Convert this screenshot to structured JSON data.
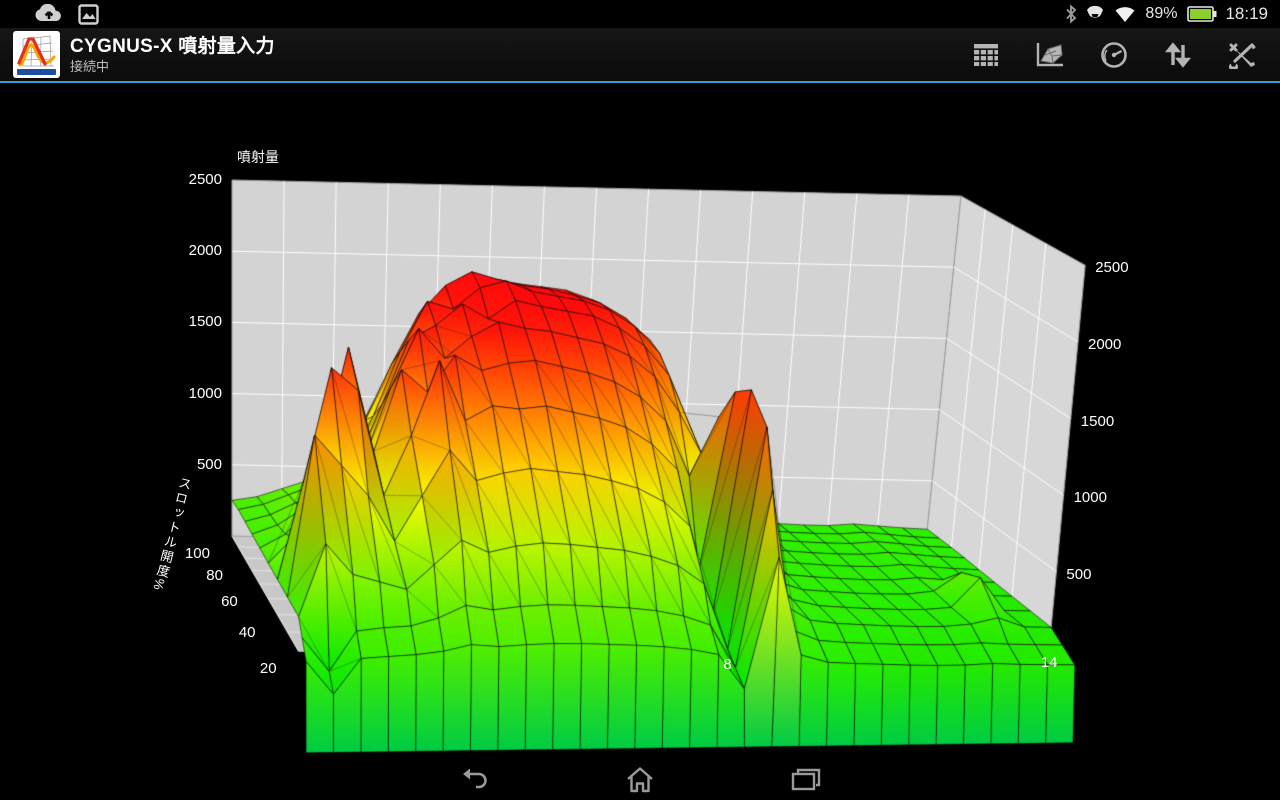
{
  "status_bar": {
    "time": "18:19",
    "battery_percent": "89%",
    "battery_color": "#8bd02a",
    "left_icons": [
      "cloud-upload",
      "gallery"
    ],
    "right_icons": [
      "bluetooth",
      "smart-connect",
      "wifi"
    ]
  },
  "app_bar": {
    "title": "CYGNUS-X 噴射量入力",
    "subtitle": "接続中",
    "accent_color": "#2f9fd0",
    "actions": [
      {
        "name": "table"
      },
      {
        "name": "surface-chart"
      },
      {
        "name": "gauge"
      },
      {
        "name": "transfer"
      },
      {
        "name": "settings-tools"
      }
    ]
  },
  "chart_data": {
    "type": "surface3d",
    "title": "噴射量",
    "y_label": "スロットル開度%",
    "zlim": [
      0,
      2500
    ],
    "z_ticks": [
      2500,
      2000,
      1500,
      1000,
      500
    ],
    "y_ticks": [
      100,
      80,
      60,
      40,
      20
    ],
    "x_ticks_shown": [
      8,
      14
    ],
    "x_range": [
      0,
      14
    ],
    "grid": true,
    "wall_color": "#d3d3d3",
    "right_wall_color": "#d7d7d7",
    "floor_color": "#c8c8c8",
    "background": "#000000",
    "palette": {
      "low": "#00e000",
      "mid": "#ffd800",
      "high": "#e83600"
    },
    "x": [
      0,
      0.5,
      1,
      1.5,
      2,
      2.5,
      3,
      3.5,
      4,
      4.5,
      5,
      5.5,
      6,
      6.5,
      7,
      7.5,
      8,
      8.5,
      9,
      9.5,
      10,
      10.5,
      11,
      11.5,
      12,
      12.5,
      13,
      13.5,
      14
    ],
    "y": [
      100,
      90,
      80,
      70,
      60,
      50,
      40,
      30,
      20,
      10,
      0
    ],
    "values": [
      [
        250,
        280,
        340,
        400,
        520,
        750,
        1100,
        1450,
        1700,
        1800,
        1850,
        1820,
        1800,
        1780,
        1720,
        1620,
        1480,
        1050,
        520,
        300,
        200,
        185,
        175,
        170,
        170,
        185,
        175,
        165,
        160
      ],
      [
        260,
        300,
        370,
        440,
        580,
        900,
        1300,
        1650,
        1850,
        1950,
        1900,
        1860,
        1840,
        1800,
        1750,
        1650,
        1500,
        1100,
        540,
        320,
        205,
        190,
        180,
        175,
        175,
        190,
        178,
        165,
        160
      ],
      [
        255,
        305,
        390,
        470,
        640,
        1000,
        1450,
        1800,
        1750,
        1900,
        1950,
        1880,
        1850,
        1820,
        1760,
        1650,
        1470,
        1080,
        540,
        330,
        210,
        192,
        182,
        176,
        176,
        192,
        180,
        166,
        160
      ],
      [
        250,
        315,
        430,
        540,
        720,
        1150,
        1600,
        1700,
        1850,
        1750,
        1880,
        1840,
        1810,
        1780,
        1700,
        1580,
        1380,
        1000,
        510,
        320,
        205,
        188,
        178,
        172,
        172,
        188,
        176,
        164,
        158
      ],
      [
        245,
        340,
        540,
        720,
        860,
        1350,
        1750,
        1550,
        1700,
        1800,
        1760,
        1740,
        1700,
        1660,
        1580,
        1440,
        1200,
        900,
        470,
        290,
        198,
        182,
        172,
        166,
        166,
        182,
        170,
        158,
        152
      ],
      [
        240,
        420,
        950,
        1700,
        1000,
        1550,
        1400,
        1650,
        1550,
        1600,
        1620,
        1580,
        1540,
        1480,
        1380,
        1220,
        850,
        1250,
        430,
        260,
        190,
        176,
        166,
        160,
        160,
        176,
        164,
        152,
        148
      ],
      [
        235,
        900,
        1650,
        1500,
        800,
        1200,
        1700,
        1300,
        1400,
        1380,
        1400,
        1360,
        1320,
        1260,
        1150,
        980,
        300,
        1500,
        390,
        235,
        182,
        170,
        160,
        155,
        155,
        176,
        300,
        148,
        144
      ],
      [
        230,
        1300,
        1100,
        900,
        600,
        900,
        1200,
        1000,
        1050,
        1080,
        1060,
        1040,
        1000,
        950,
        860,
        700,
        80,
        1600,
        340,
        215,
        175,
        164,
        155,
        150,
        150,
        164,
        360,
        144,
        140
      ],
      [
        225,
        700,
        500,
        450,
        400,
        560,
        720,
        640,
        680,
        700,
        690,
        670,
        650,
        610,
        550,
        430,
        0,
        1450,
        290,
        190,
        168,
        158,
        150,
        145,
        145,
        160,
        200,
        140,
        136
      ],
      [
        220,
        0,
        260,
        280,
        290,
        340,
        420,
        390,
        410,
        420,
        415,
        405,
        395,
        375,
        340,
        280,
        0,
        1150,
        245,
        175,
        160,
        152,
        144,
        140,
        140,
        150,
        140,
        136,
        132
      ],
      [
        215,
        0,
        230,
        240,
        250,
        270,
        310,
        295,
        305,
        310,
        308,
        300,
        292,
        280,
        260,
        225,
        0,
        850,
        215,
        165,
        155,
        148,
        140,
        136,
        136,
        144,
        136,
        132,
        128
      ]
    ]
  },
  "nav_bar": {
    "buttons": [
      "back",
      "home",
      "recents"
    ]
  }
}
